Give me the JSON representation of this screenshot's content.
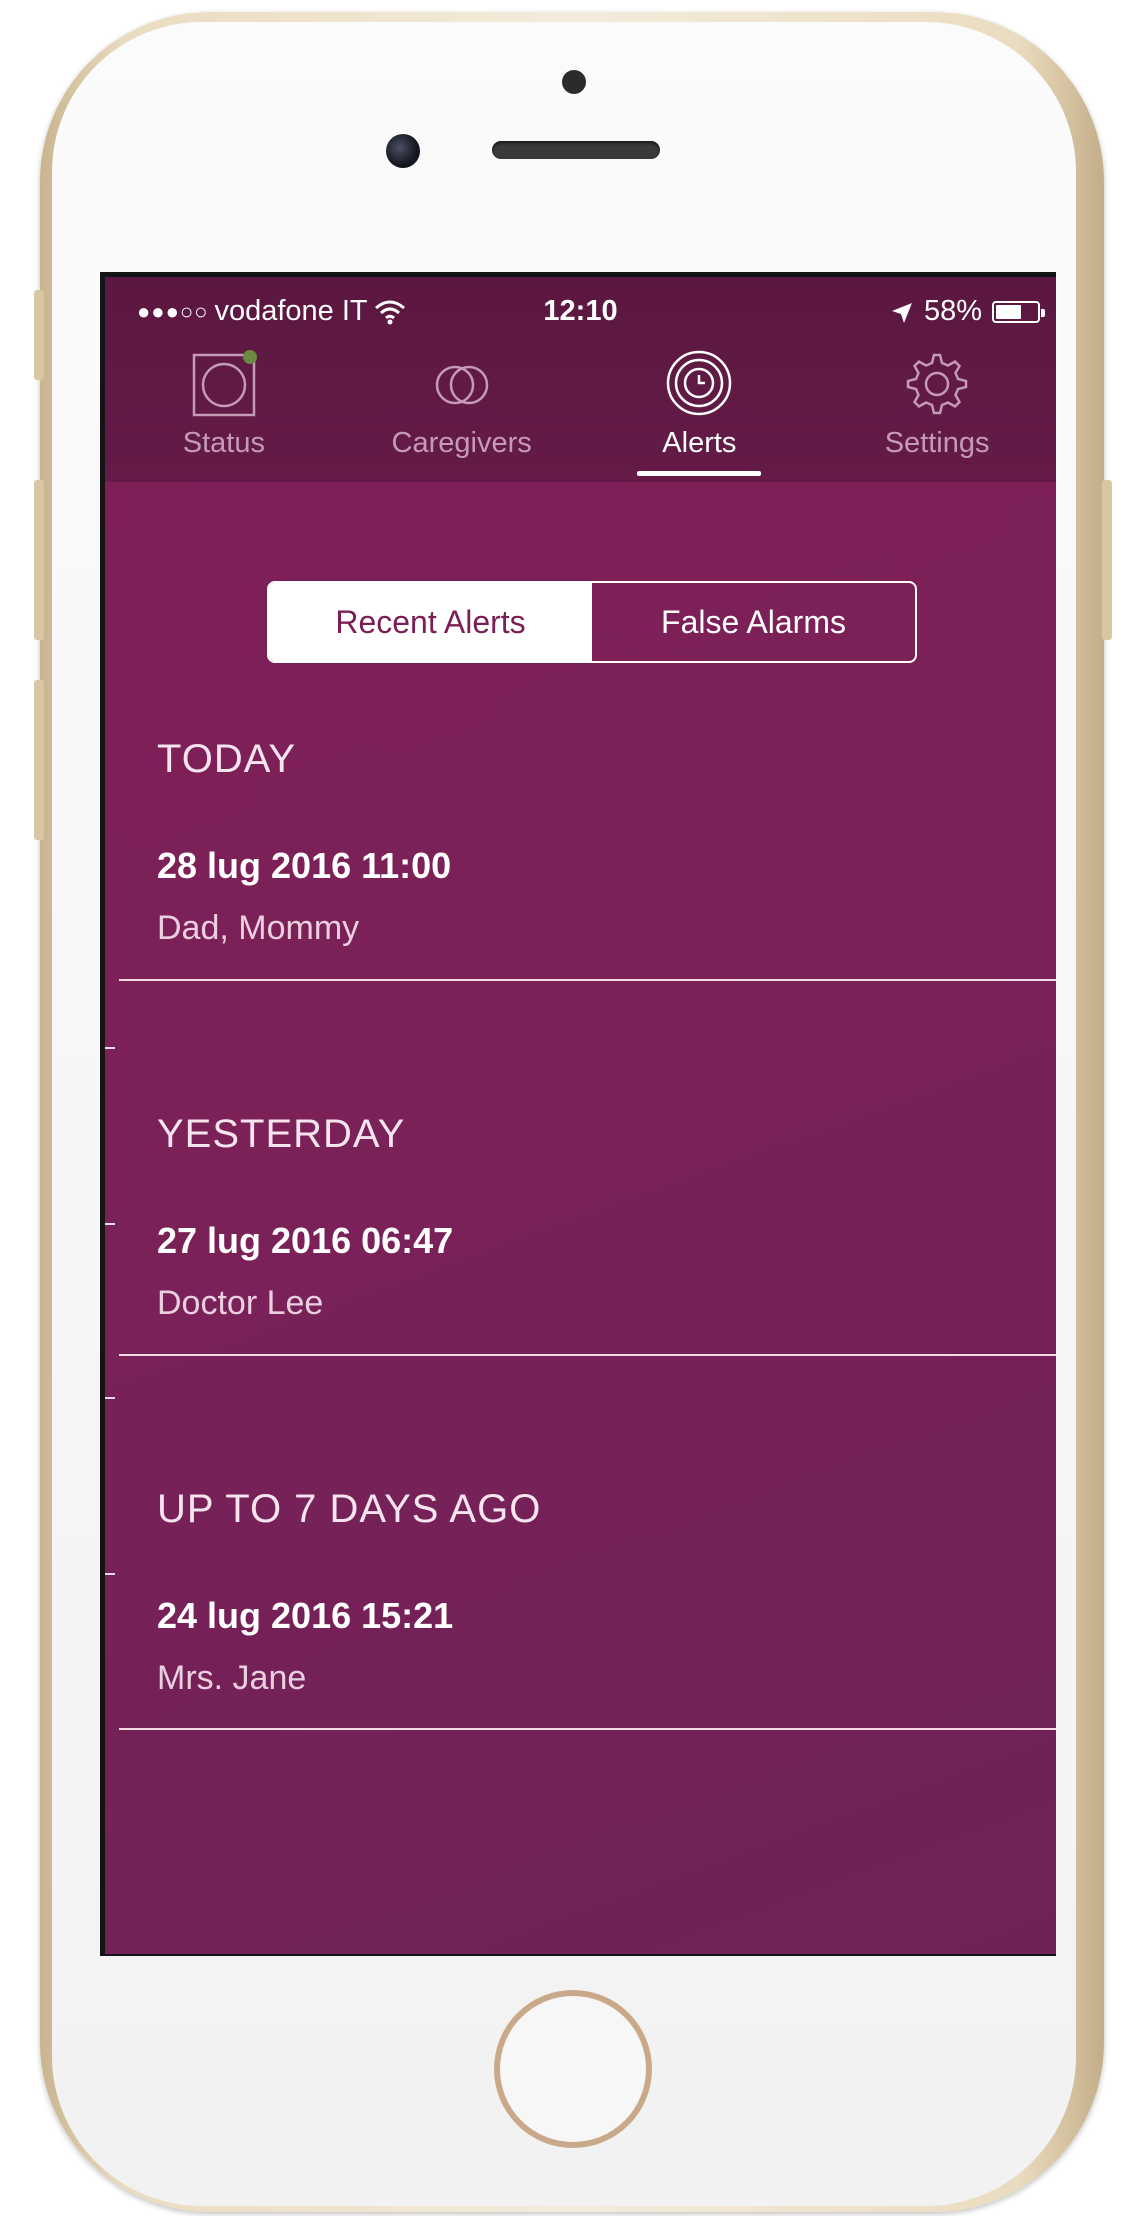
{
  "status_bar": {
    "signal": "●●●○○",
    "carrier": "vodafone IT",
    "time": "12:10",
    "battery_percent": "58%"
  },
  "tabs": [
    {
      "label": "Status",
      "icon": "status-icon",
      "active": false
    },
    {
      "label": "Caregivers",
      "icon": "caregivers-icon",
      "active": false
    },
    {
      "label": "Alerts",
      "icon": "alerts-icon",
      "active": true
    },
    {
      "label": "Settings",
      "icon": "gear-icon",
      "active": false
    }
  ],
  "segmented": {
    "recent_label": "Recent Alerts",
    "false_label": "False Alarms",
    "selected": "Recent Alerts"
  },
  "sections": [
    {
      "heading": "TODAY",
      "alerts": [
        {
          "time": "28 lug 2016 11:00",
          "names": "Dad, Mommy"
        }
      ]
    },
    {
      "heading": "YESTERDAY",
      "alerts": [
        {
          "time": "27 lug 2016 06:47",
          "names": "Doctor Lee"
        }
      ]
    },
    {
      "heading": "UP TO 7 DAYS AGO",
      "alerts": [
        {
          "time": "24 lug 2016 15:21",
          "names": "Mrs. Jane"
        }
      ]
    }
  ],
  "colors": {
    "background": "#7c2158",
    "header": "#5f1943",
    "accent": "#ffffff",
    "status_dot": "#6b8a3f"
  }
}
